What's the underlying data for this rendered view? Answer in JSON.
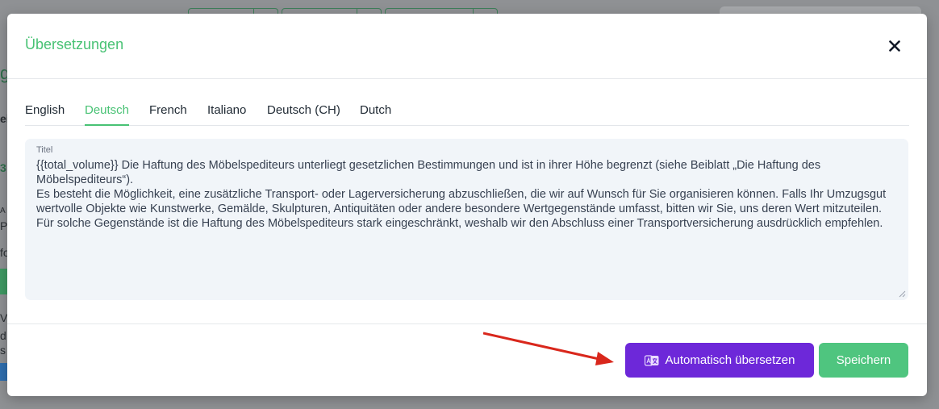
{
  "background": {
    "fragments": [
      "g",
      "ei",
      "3",
      "A",
      "P",
      "fo",
      "V",
      "d",
      "s"
    ],
    "colors": {
      "overlay": "#8f9194",
      "accent_green": "#2f6f4b"
    }
  },
  "modal": {
    "title": "Übersetzungen",
    "close_icon": "close-icon",
    "tabs": [
      {
        "label": "English",
        "active": false
      },
      {
        "label": "Deutsch",
        "active": true
      },
      {
        "label": "French",
        "active": false
      },
      {
        "label": "Italiano",
        "active": false
      },
      {
        "label": "Deutsch (CH)",
        "active": false
      },
      {
        "label": "Dutch",
        "active": false
      }
    ],
    "field": {
      "label": "Titel",
      "value": "{{total_volume}} Die Haftung des Möbelspediteurs unterliegt gesetzlichen Bestimmungen und ist in ihrer Höhe begrenzt (siehe Beiblatt „Die Haftung des Möbelspediteurs“).\nEs besteht die Möglichkeit, eine zusätzliche Transport- oder Lagerversicherung abzuschließen, die wir auf Wunsch für Sie organisieren können. Falls Ihr Umzugsgut wertvolle Objekte wie Kunstwerke, Gemälde, Skulpturen, Antiquitäten oder andere besondere Wertgegenstände umfasst, bitten wir Sie, uns deren Wert mitzuteilen.\nFür solche Gegenstände ist die Haftung des Möbelspediteurs stark eingeschränkt, weshalb wir den Abschluss einer Transportversicherung ausdrücklich empfehlen."
    },
    "buttons": {
      "auto_translate": {
        "label": "Automatisch übersetzen",
        "icon": "translate-icon"
      },
      "save": {
        "label": "Speichern"
      }
    },
    "colors": {
      "title": "#48c274",
      "active_tab": "#48c274",
      "auto_translate_bg": "#6d28d9",
      "save_bg": "#4fc57f",
      "annotation_arrow": "#d9271c"
    }
  }
}
